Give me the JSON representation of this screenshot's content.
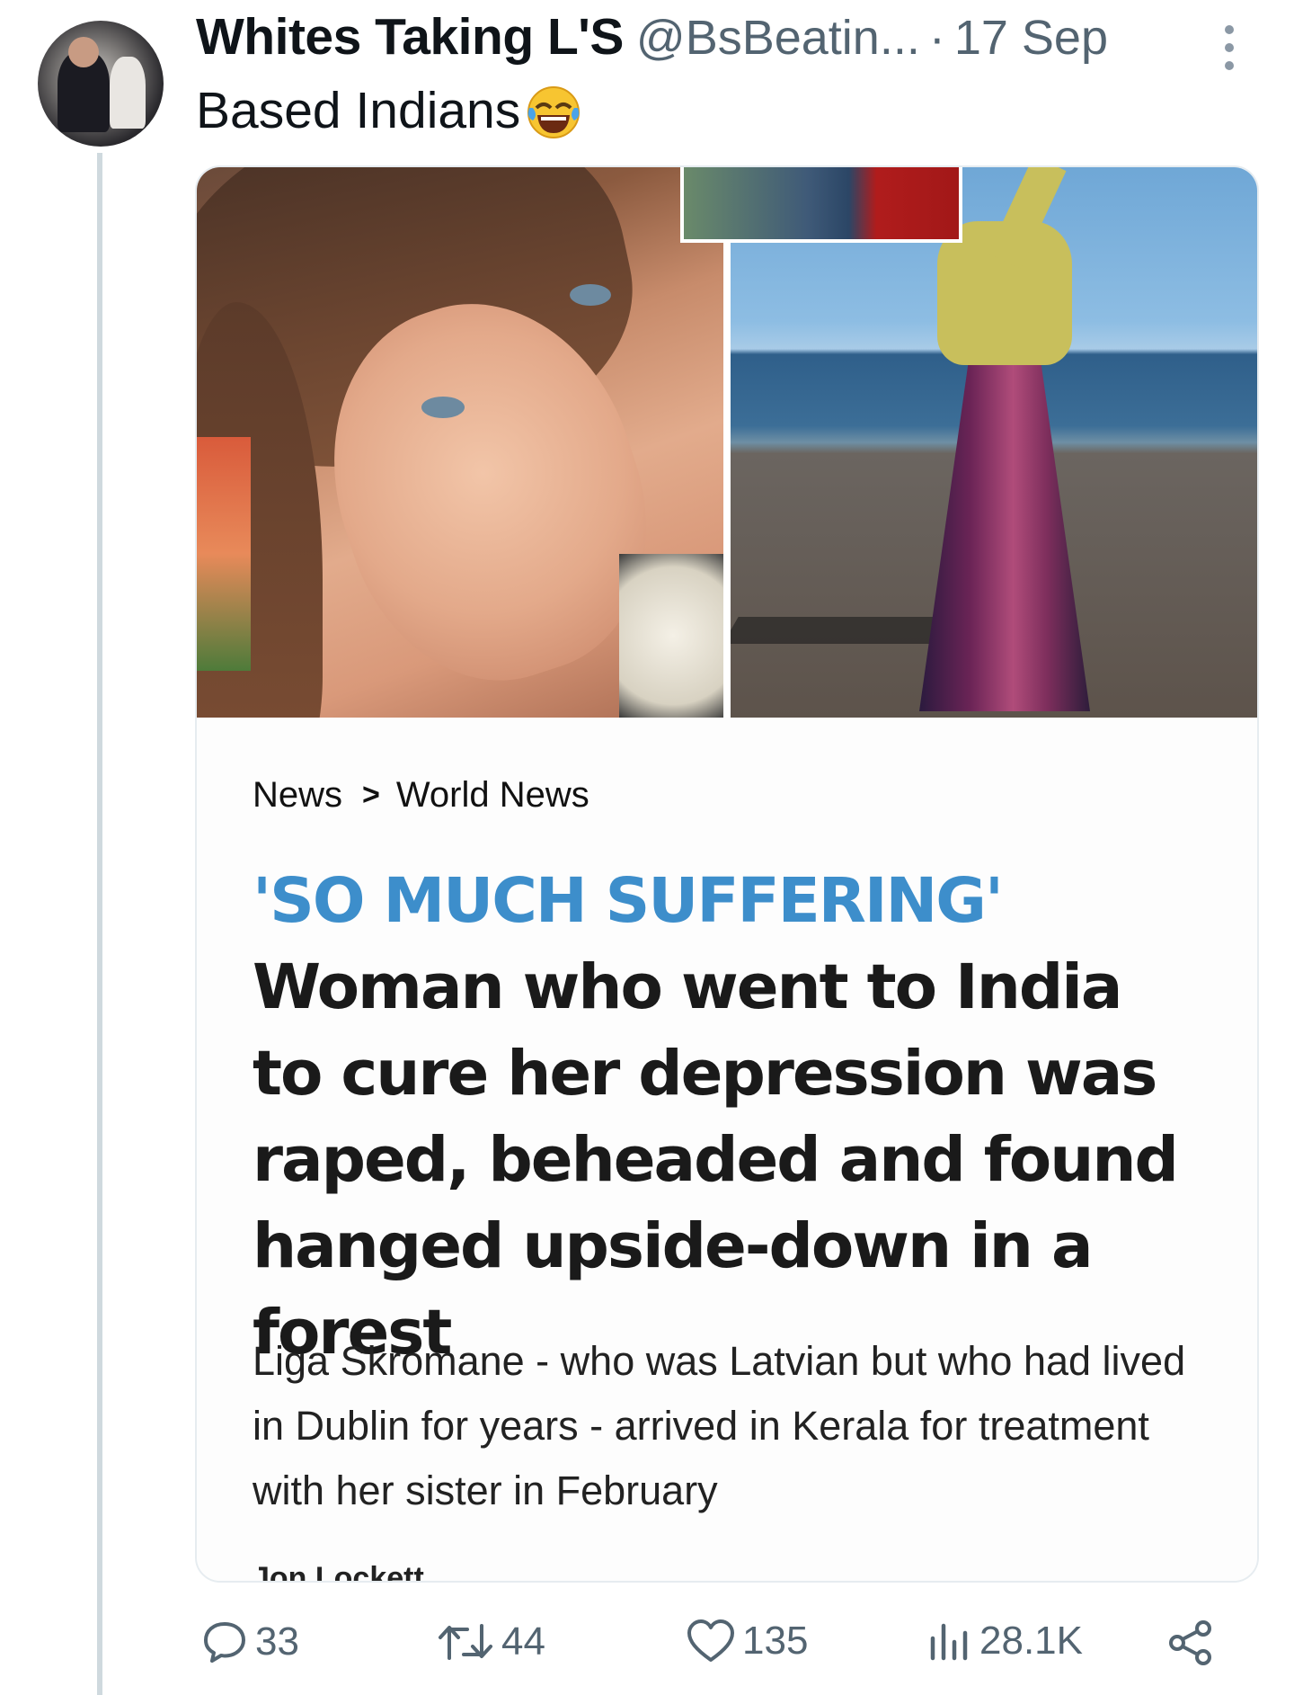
{
  "tweet": {
    "display_name": "Whites Taking L'S",
    "handle": "@BsBeatin...",
    "separator": "·",
    "date": "17 Sep",
    "text": "Based Indians",
    "emoji": "face-with-tears-of-joy-icon"
  },
  "card": {
    "breadcrumb": [
      "News",
      "World News"
    ],
    "headline_kicker": "'SO MUCH SUFFERING'",
    "headline_rest": "Woman who went to India to cure her depression was raped, beheaded and found hanged upside-down in a forest",
    "standfirst": "Liga Skromane - who was Latvian but who had lived in Dublin for years -  arrived in Kerala for treatment with her sister in February",
    "byline": "Jon Lockett"
  },
  "actions": {
    "replies": "33",
    "reposts": "44",
    "likes": "135",
    "views": "28.1K"
  },
  "colors": {
    "kicker": "#3d8ecb",
    "meta_text": "#536471",
    "thread_line": "#cfd9de"
  }
}
